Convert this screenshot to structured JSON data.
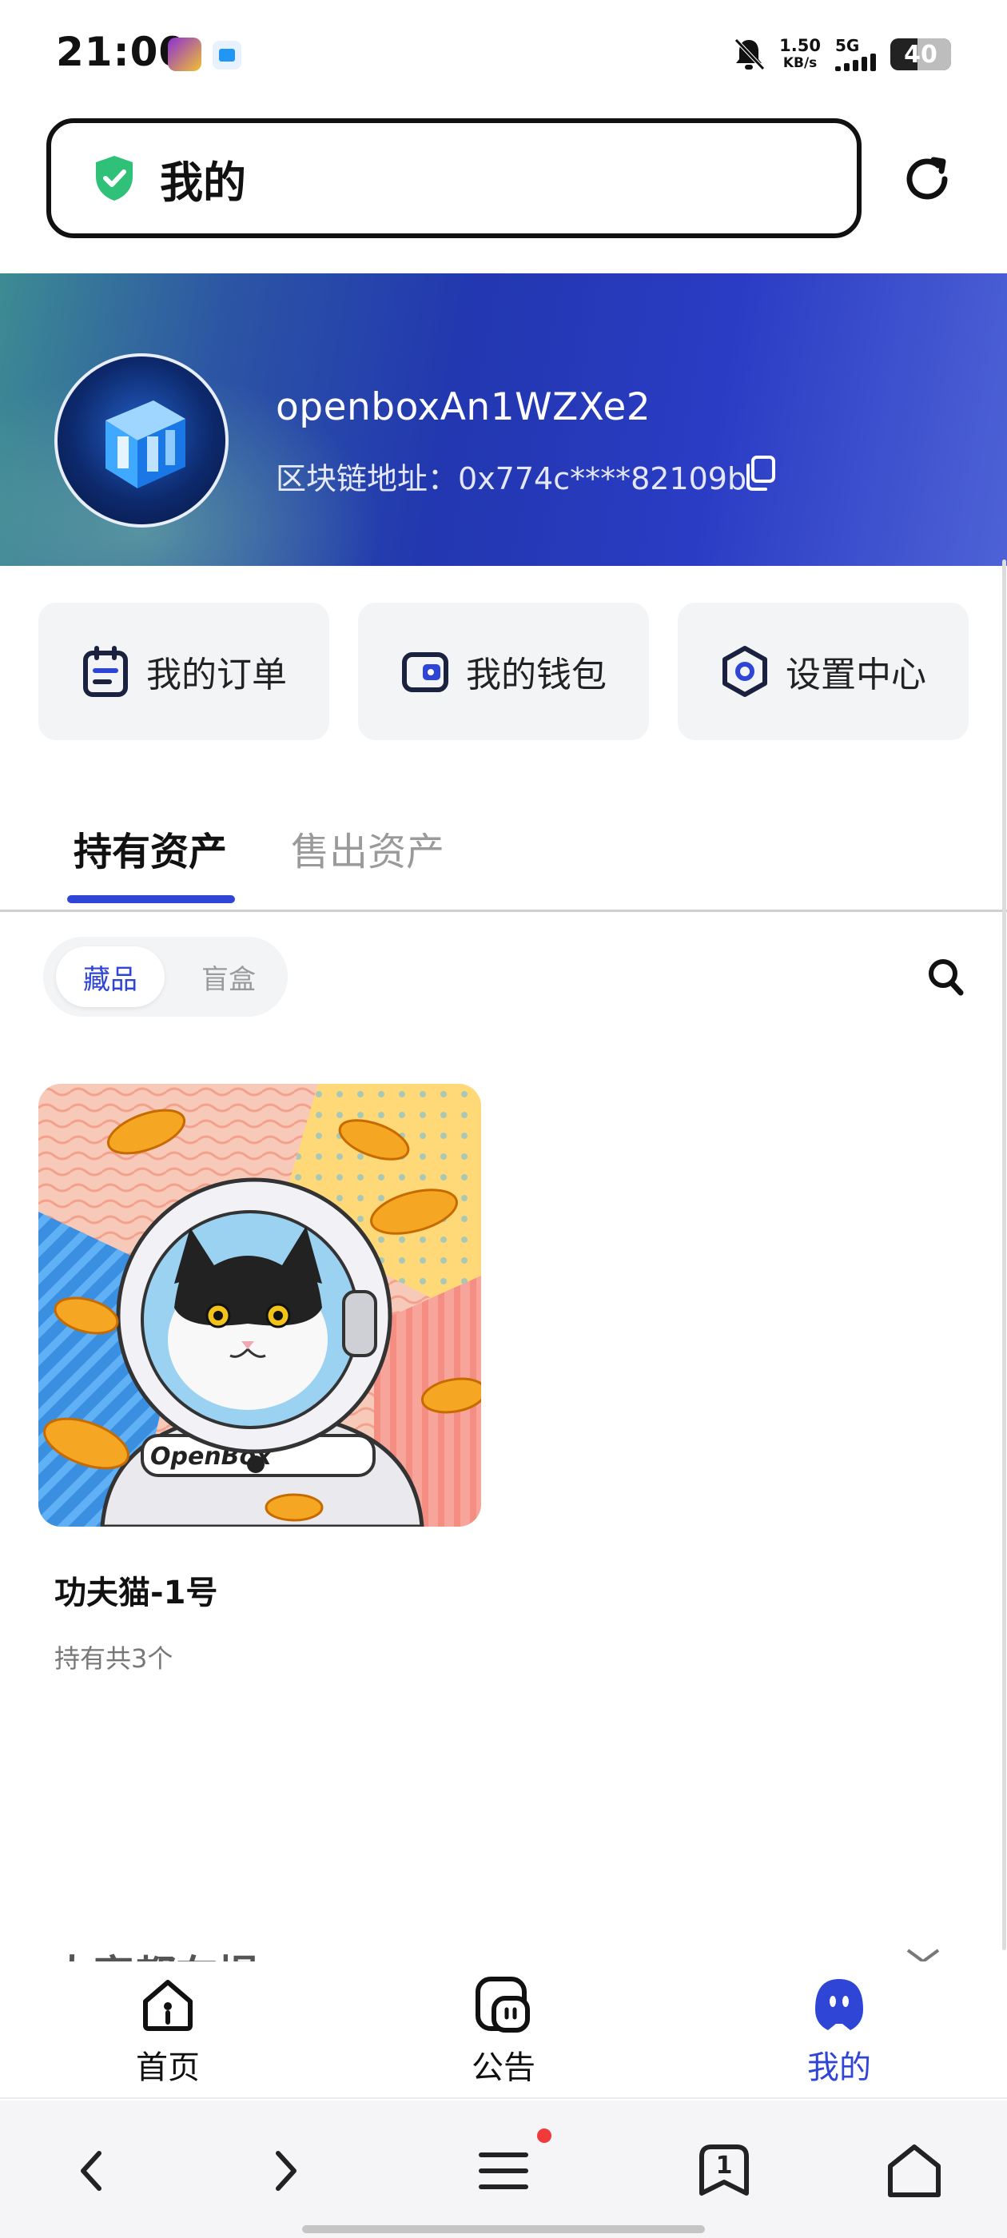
{
  "status_bar": {
    "time": "21:00",
    "net_speed_value": "1.50",
    "net_speed_unit": "KB/s",
    "network_type": "5G",
    "battery_level": "40",
    "icons": [
      "app-icon-game",
      "app-icon-blue",
      "bell-muted-icon",
      "signal-icon",
      "battery-icon"
    ]
  },
  "address_bar": {
    "title": "我的",
    "secure_icon": "shield-check-icon",
    "reload_icon": "reload-icon"
  },
  "profile": {
    "username": "openboxAn1WZXe2",
    "chain_address_label": "区块链地址：",
    "chain_address": "0x774c****82109b",
    "copy_icon": "copy-icon"
  },
  "quick_actions": [
    {
      "label": "我的订单",
      "icon": "order-icon"
    },
    {
      "label": "我的钱包",
      "icon": "wallet-icon"
    },
    {
      "label": "设置中心",
      "icon": "settings-icon"
    }
  ],
  "asset_tabs": {
    "active": "持有资产",
    "inactive": "售出资产"
  },
  "filter": {
    "active": "藏品",
    "inactive": "盲盒",
    "search_icon": "search-icon"
  },
  "items": [
    {
      "name": "功夫猫-1号",
      "count_text": "持有共3个",
      "image_badge_text": "OpenBox"
    }
  ],
  "partial_section": {
    "title": "大家都在提"
  },
  "app_nav": [
    {
      "label": "首页",
      "icon": "home-icon",
      "active": false
    },
    {
      "label": "公告",
      "icon": "announcement-icon",
      "active": false
    },
    {
      "label": "我的",
      "icon": "profile-icon",
      "active": true
    }
  ],
  "browser_bar": {
    "tab_count": "1",
    "icons": [
      "back-icon",
      "forward-icon",
      "menu-icon",
      "tabs-icon",
      "home-icon"
    ]
  },
  "colors": {
    "accent": "#2f45d6",
    "shield_green": "#2fc177",
    "notification_red": "#f03a3a"
  }
}
